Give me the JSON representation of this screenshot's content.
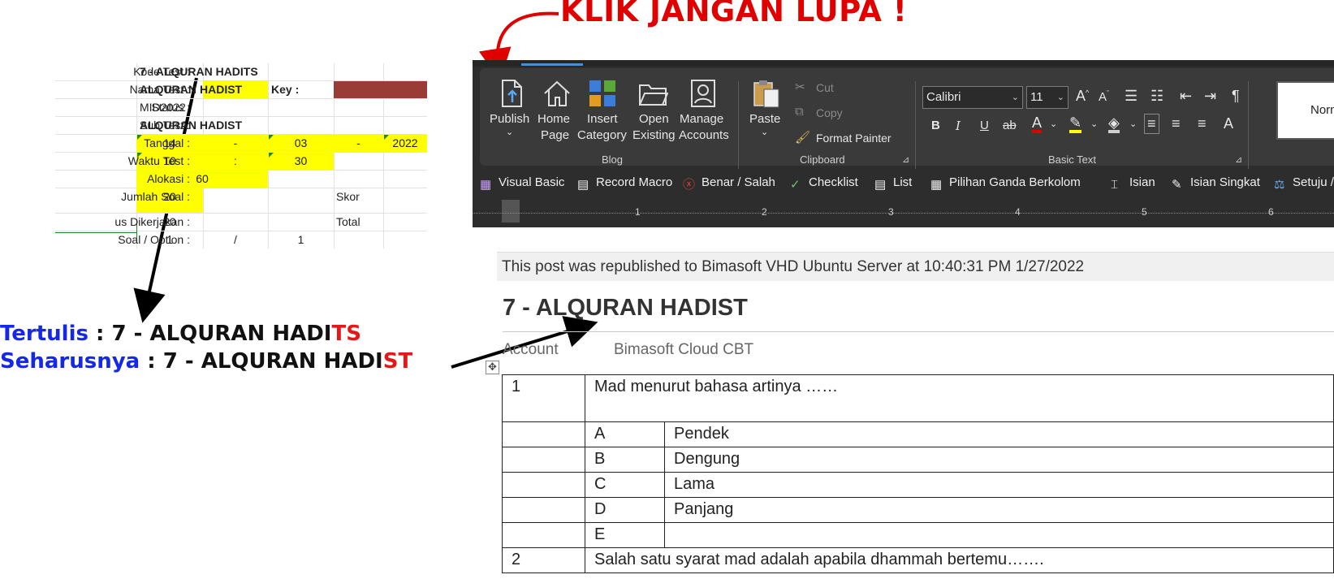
{
  "annotation": {
    "click_reminder": "KLIK JANGAN LUPA !",
    "written_label": "Tertulis",
    "written_value_main": " : 7 - ALQURAN HADI",
    "written_value_err": "TS",
    "should_label": "Seharusnya",
    "should_value_main": " : 7 - ALQURAN HADI",
    "should_value_fix": "ST"
  },
  "sheet": {
    "kode_label": "Kode Test :",
    "kode_value": "7 - ALQURAN HADITS",
    "nama_label": "Nama Test :",
    "nama_value_a": "ALQURAN",
    "nama_value_b": "HADIST",
    "key_label": "Key :",
    "status_label": "Status :",
    "status_value": "MID2022",
    "subtest_label": "Sub Test :",
    "subtest_value": "ALQURAN HADIST",
    "tanggal_label": "Tanggal :",
    "tanggal_day": "14",
    "tanggal_sep1": "-",
    "tanggal_month": "03",
    "tanggal_sep2": "-",
    "tanggal_year": "2022",
    "waktu_label": "Waktu Test :",
    "waktu_h": "10",
    "waktu_sep": ":",
    "waktu_m": "30",
    "alokasi_label": "Alokasi :",
    "alokasi_value": "60",
    "jumlah_label": "Jumlah Soal :",
    "jumlah_value": "20",
    "skor_label": "Skor",
    "dikerjakan_label": "us Dikerjakan :",
    "dikerjakan_value": "20",
    "total_label": "Total",
    "option_label": "Soal / Option :",
    "option_a": "1",
    "option_sep": "/",
    "option_b": "1"
  },
  "ribbon": {
    "blog": {
      "publish": "Publish",
      "home_page_1": "Home",
      "home_page_2": "Page",
      "insert_cat_1": "Insert",
      "insert_cat_2": "Category",
      "open_1": "Open",
      "open_2": "Existing",
      "manage_1": "Manage",
      "manage_2": "Accounts",
      "group": "Blog"
    },
    "clipboard": {
      "paste": "Paste",
      "cut": "Cut",
      "copy": "Copy",
      "format_painter": "Format Painter",
      "group": "Clipboard"
    },
    "basic_text": {
      "font": "Calibri",
      "size": "11",
      "group": "Basic Text"
    },
    "style_normal": "Normal",
    "quick": {
      "visual_basic": "Visual Basic",
      "record_macro": "Record Macro",
      "benar_salah": "Benar / Salah",
      "checklist": "Checklist",
      "list": "List",
      "pilihan_ganda": "Pilihan Ganda Berkolom",
      "isian": "Isian",
      "isian_singkat": "Isian Singkat",
      "setuju": "Setuju /"
    },
    "ruler": [
      "1",
      "2",
      "3",
      "4",
      "5",
      "6"
    ]
  },
  "document": {
    "notice": "This post was republished to Bimasoft VHD Ubuntu Server at 10:40:31 PM 1/27/2022",
    "title": "7 - ALQURAN HADIST",
    "account_label": "Account",
    "account_value": "Bimasoft Cloud CBT",
    "q1_num": "1",
    "q1_text": "Mad menurut bahasa artinya ……",
    "options": [
      {
        "key": "A",
        "text": "Pendek"
      },
      {
        "key": "B",
        "text": "Dengung"
      },
      {
        "key": "C",
        "text": "Lama"
      },
      {
        "key": "D",
        "text": "Panjang"
      },
      {
        "key": "E",
        "text": ""
      }
    ],
    "q2_num": "2",
    "q2_text": "Salah satu syarat mad adalah apabila dhammah bertemu……."
  },
  "colors": {
    "annotation_red": "#e00000",
    "label_blue": "#1428e6",
    "sheet_yellow": "#ffff00",
    "key_brown": "#9a3b36"
  }
}
